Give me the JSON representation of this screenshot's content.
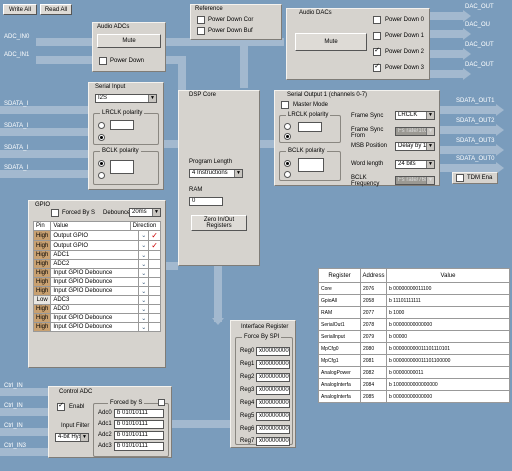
{
  "toolbar": {
    "write_all": "Write All",
    "read_all": "Read All"
  },
  "signals": {
    "adc_in0": "ADC_IN0",
    "adc_in1": "ADC_IN1",
    "sdata_in": [
      "SDATA_I",
      "SDATA_I",
      "SDATA_I",
      "SDATA_I"
    ],
    "dac_out": [
      "DAC_OUT",
      "DAC_OU",
      "DAC_OUT",
      "DAC_OUT"
    ],
    "sdata_out": [
      "SDATA_OUT1",
      "SDATA_OUT2",
      "SDATA_OUT3",
      "SDATA_OUT0"
    ],
    "ctrl_in": [
      "Ctrl_IN",
      "Ctrl_IN",
      "Ctrl_IN",
      "Ctrl_IN3"
    ]
  },
  "audio_adcs": {
    "title": "Audio ADCs",
    "mute": "Mute",
    "power_down": "Power Down"
  },
  "reference": {
    "title": "Reference",
    "pd_cor": "Power Down Cor",
    "pd_buf": "Power Down Buf"
  },
  "audio_dacs": {
    "title": "Audio DACs",
    "mute": "Mute",
    "power_down": [
      {
        "label": "Power Down 0",
        "checked": false
      },
      {
        "label": "Power Down 1",
        "checked": false
      },
      {
        "label": "Power Down 2",
        "checked": true
      },
      {
        "label": "Power Down 3",
        "checked": true
      }
    ]
  },
  "serial_input": {
    "title": "Serial Input",
    "format": "I2S",
    "lrclk_polarity": "LRCLK polarity",
    "bclk_polarity": "BCLK polarity"
  },
  "dsp_core": {
    "title": "DSP Core",
    "program_length_label": "Program Length",
    "program_length": "4 Instructions",
    "ram_label": "RAM",
    "ram_value": "0",
    "zero_button": "Zero In/Out Registers"
  },
  "serial_output": {
    "title": "Serial Output 1 (channels 0-7)",
    "master_mode": "Master Mode",
    "lrclk_polarity": "LRCLK polarity",
    "bclk_polarity": "BCLK polarity",
    "frame_sync_label": "Frame Sync",
    "frame_sync": "LRCLK",
    "frame_sync_from_label": "Frame Sync From",
    "frame_sync_from": "Fs rate/1024",
    "msb_position_label": "MSB Position",
    "msb_position": "Delay by 1",
    "word_length_label": "Word length",
    "word_length": "24 bits",
    "bclk_label": "BCLK Frequency",
    "bclk": "Fs rate/768",
    "tdm_enable": "TDM Ena"
  },
  "gpio": {
    "title": "GPIO",
    "forced_by": "Forced By S",
    "debounce_label": "Debounce",
    "debounce": "20ms",
    "headers": [
      "Pin",
      "Value",
      "Direction"
    ],
    "rows": [
      {
        "pin": "High",
        "value": "Output GPIO",
        "checked": true
      },
      {
        "pin": "High",
        "value": "Output GPIO",
        "checked": true
      },
      {
        "pin": "High",
        "value": "ADC1",
        "checked": false
      },
      {
        "pin": "High",
        "value": "ADC2",
        "checked": false
      },
      {
        "pin": "High",
        "value": "Input GPIO Debounce",
        "checked": false
      },
      {
        "pin": "High",
        "value": "Input GPIO Debounce",
        "checked": false
      },
      {
        "pin": "High",
        "value": "Input GPIO Debounce",
        "checked": false
      },
      {
        "pin": "Low",
        "value": "ADC3",
        "checked": false
      },
      {
        "pin": "High",
        "value": "ADC0",
        "checked": false
      },
      {
        "pin": "High",
        "value": "Input GPIO Debounce",
        "checked": false
      },
      {
        "pin": "High",
        "value": "Input GPIO Debounce",
        "checked": false
      }
    ]
  },
  "interface_register": {
    "title": "Interface Register",
    "forced_by_spi": "Force By SPI",
    "regs": [
      {
        "name": "Reg0",
        "value": "x00000000"
      },
      {
        "name": "Reg1",
        "value": "x00000000"
      },
      {
        "name": "Reg2",
        "value": "x00000000"
      },
      {
        "name": "Reg3",
        "value": "x00000000"
      },
      {
        "name": "Reg4",
        "value": "x00000000"
      },
      {
        "name": "Reg5",
        "value": "x00000000"
      },
      {
        "name": "Reg6",
        "value": "x00000000"
      },
      {
        "name": "Reg7",
        "value": "x00000000"
      }
    ]
  },
  "control_adc": {
    "title": "Control ADC",
    "enable": "Enabl",
    "forced_by": "Forced by S",
    "input_filter_label": "Input Filter",
    "input_filter": "4-bit Hyst",
    "adcs": [
      {
        "name": "Adc0",
        "value": "b 01010111"
      },
      {
        "name": "Adc1",
        "value": "b 01010111"
      },
      {
        "name": "Adc2",
        "value": "b 01010111"
      },
      {
        "name": "Adc3",
        "value": "b 01010111"
      }
    ]
  },
  "register_table": {
    "headers": [
      "Register",
      "Address",
      "Value"
    ],
    "rows": [
      {
        "reg": "Core",
        "addr": "2076",
        "val": "b 00000000011100"
      },
      {
        "reg": "GpioAll",
        "addr": "2058",
        "val": "b 11101111111"
      },
      {
        "reg": "RAM",
        "addr": "2077",
        "val": "b 1000"
      },
      {
        "reg": "SerialOut1",
        "addr": "2078",
        "val": "b 00000000000000"
      },
      {
        "reg": "SerialInput",
        "addr": "2079",
        "val": "b 00000"
      },
      {
        "reg": "MpCfg0",
        "addr": "2080",
        "val": "b 000000000011101110101"
      },
      {
        "reg": "MpCfg1",
        "addr": "2081",
        "val": "b 000000000011101100000"
      },
      {
        "reg": "AnalogPower",
        "addr": "2082",
        "val": "b 00000000011"
      },
      {
        "reg": "AnalogInterfa",
        "addr": "2084",
        "val": "b 1000000000000000"
      },
      {
        "reg": "AnalogInterfa",
        "addr": "2085",
        "val": "b 00000000000000"
      }
    ]
  }
}
